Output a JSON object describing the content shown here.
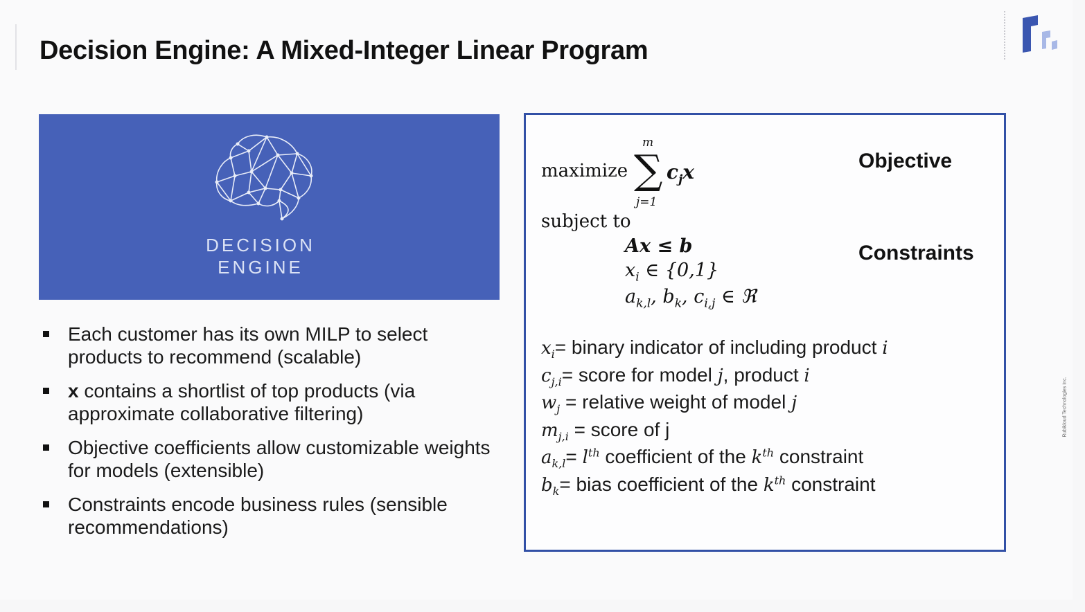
{
  "title": "Decision Engine: A Mixed-Integer Linear Program",
  "side_text": "Rubikloud Technologies Inc.",
  "hero": {
    "line1": "DECISION",
    "line2": "ENGINE"
  },
  "bullets": [
    {
      "bold": "",
      "text": "Each customer has its own MILP to select products to recommend (scalable)"
    },
    {
      "bold": "x",
      "text": " contains a shortlist of top products (via approximate collaborative filtering)"
    },
    {
      "bold": "",
      "text": "Objective coefficients allow customizable weights for models (extensible)"
    },
    {
      "bold": "",
      "text": "Constraints encode business rules (sensible recommendations)"
    }
  ],
  "formula": {
    "maximize": "maximize",
    "sum_upper": "m",
    "sum_lower": "j=1",
    "objective_c": "c",
    "objective_sub": "j",
    "objective_x": "x",
    "subject_to": "subject to",
    "c1": "Ax ≤ b",
    "c2_var": "x",
    "c2_sub": "i",
    "c2_rest": " ∈ {0,1}",
    "c3_a": "a",
    "c3_a_sub": "k,l",
    "c3_b": ", b",
    "c3_b_sub": "k",
    "c3_c": ", c",
    "c3_c_sub": "i,j",
    "c3_rest": " ∈ ℜ"
  },
  "labels": {
    "objective": "Objective",
    "constraints": "Constraints"
  },
  "definitions": {
    "d1_sym": "x",
    "d1_sub": "i",
    "d1_text": "= binary indicator of including product ",
    "d1_var": "i",
    "d2_sym": "c",
    "d2_sub": "j,i",
    "d2_text": "= score for model ",
    "d2_var1": "j",
    "d2_mid": ", product ",
    "d2_var2": "i",
    "d3_sym": "w",
    "d3_sub": "j",
    "d3_text": "  = relative weight of model ",
    "d3_var": "j",
    "d4_sym": "m",
    "d4_sub": "j,i",
    "d4_text": " = score of j",
    "d5_sym": "a",
    "d5_sub": "k,l",
    "d5_eq": "= ",
    "d5_l": "l",
    "d5_l_sup": "th",
    "d5_text": " coefficient of the ",
    "d5_k": "k",
    "d5_k_sup": "th",
    "d5_end": " constraint",
    "d6_sym": "b",
    "d6_sub": "k",
    "d6_text": "= bias coefficient of the ",
    "d6_k": "k",
    "d6_k_sup": "th",
    "d6_end": " constraint"
  },
  "colors": {
    "hero_bg": "#4661b8",
    "box_border": "#3250a6",
    "logo_dark": "#3a56b0",
    "logo_light": "#a8b8e6"
  }
}
